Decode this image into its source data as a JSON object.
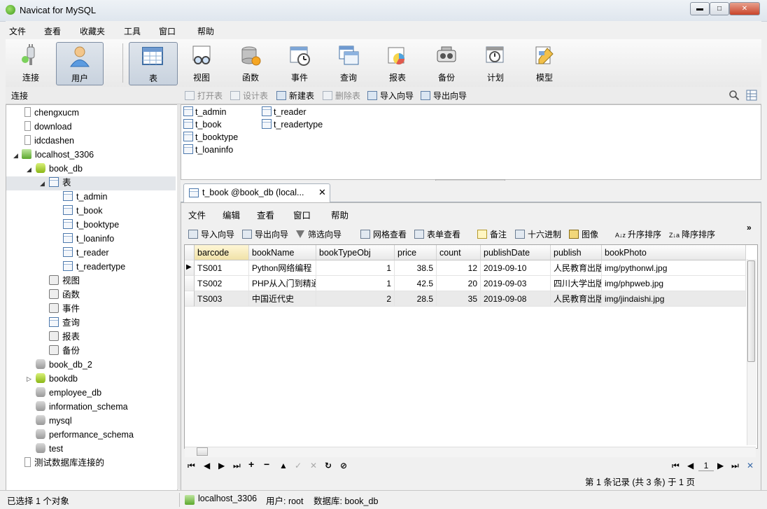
{
  "window": {
    "title": "Navicat for MySQL",
    "min": "▬",
    "max": "□",
    "close": "✕"
  },
  "menu": [
    "文件",
    "查看",
    "收藏夹",
    "工具",
    "窗口",
    "帮助"
  ],
  "toolbar": {
    "connect": "连接",
    "user": "用户",
    "table": "表",
    "view": "视图",
    "function": "函数",
    "event": "事件",
    "query": "查询",
    "report": "报表",
    "backup": "备份",
    "schedule": "计划",
    "model": "模型"
  },
  "subbar": {
    "section": "连接",
    "open_table": "打开表",
    "design_table": "设计表",
    "new_table": "新建表",
    "delete_table": "删除表",
    "import_wizard": "导入向导",
    "export_wizard": "导出向导"
  },
  "tree": {
    "items": [
      "chengxucm",
      "download",
      "idcdashen",
      "localhost_3306",
      "book_db",
      "表",
      "t_admin",
      "t_book",
      "t_booktype",
      "t_loaninfo",
      "t_reader",
      "t_readertype",
      "视图",
      "函数",
      "事件",
      "查询",
      "报表",
      "备份",
      "book_db_2",
      "bookdb",
      "employee_db",
      "information_schema",
      "mysql",
      "performance_schema",
      "test",
      "测试数据库连接的"
    ]
  },
  "objects": [
    "t_admin",
    "t_book",
    "t_booktype",
    "t_loaninfo",
    "t_reader",
    "t_readertype"
  ],
  "tab": {
    "label": "t_book @book_db (local...",
    "close": "✕"
  },
  "editor_menu": [
    "文件",
    "编辑",
    "查看",
    "窗口",
    "帮助"
  ],
  "editor_toolbar": {
    "import": "导入向导",
    "export": "导出向导",
    "filter": "筛选向导",
    "grid_view": "网格查看",
    "form_view": "表单查看",
    "memo": "备注",
    "hex": "十六进制",
    "image": "图像",
    "sort_asc": "升序排序",
    "sort_desc": "降序排序",
    "more": "»"
  },
  "grid": {
    "columns": [
      "barcode",
      "bookName",
      "bookTypeObj",
      "price",
      "count",
      "publishDate",
      "publish",
      "bookPhoto"
    ],
    "rows": [
      [
        "TS001",
        "Python网络编程",
        "1",
        "38.5",
        "12",
        "2019-09-10",
        "人民教育出版",
        "img/pythonwl.jpg"
      ],
      [
        "TS002",
        "PHP从入门到精通",
        "1",
        "42.5",
        "20",
        "2019-09-03",
        "四川大学出版",
        "img/phpweb.jpg"
      ],
      [
        "TS003",
        "中国近代史",
        "2",
        "28.5",
        "35",
        "2019-09-08",
        "人民教育出版",
        "img/jindaishi.jpg"
      ]
    ],
    "current_row_marker": "▶"
  },
  "nav": {
    "first": "⏮",
    "prev": "◀",
    "next": "▶",
    "last": "⏭",
    "add": "+",
    "delete": "−",
    "up": "▲",
    "check": "✓",
    "cancel": "✕",
    "refresh": "↻",
    "stop": "⊘",
    "page": "1"
  },
  "record_info": "第 1 条记录 (共 3 条) 于 1 页",
  "status": {
    "selection": "已选择 1 个对象",
    "connection": "localhost_3306",
    "user": "用户: root",
    "database": "数据库: book_db"
  },
  "colors": {
    "accent": "#4d79ad",
    "selected": "#c8d2de"
  }
}
